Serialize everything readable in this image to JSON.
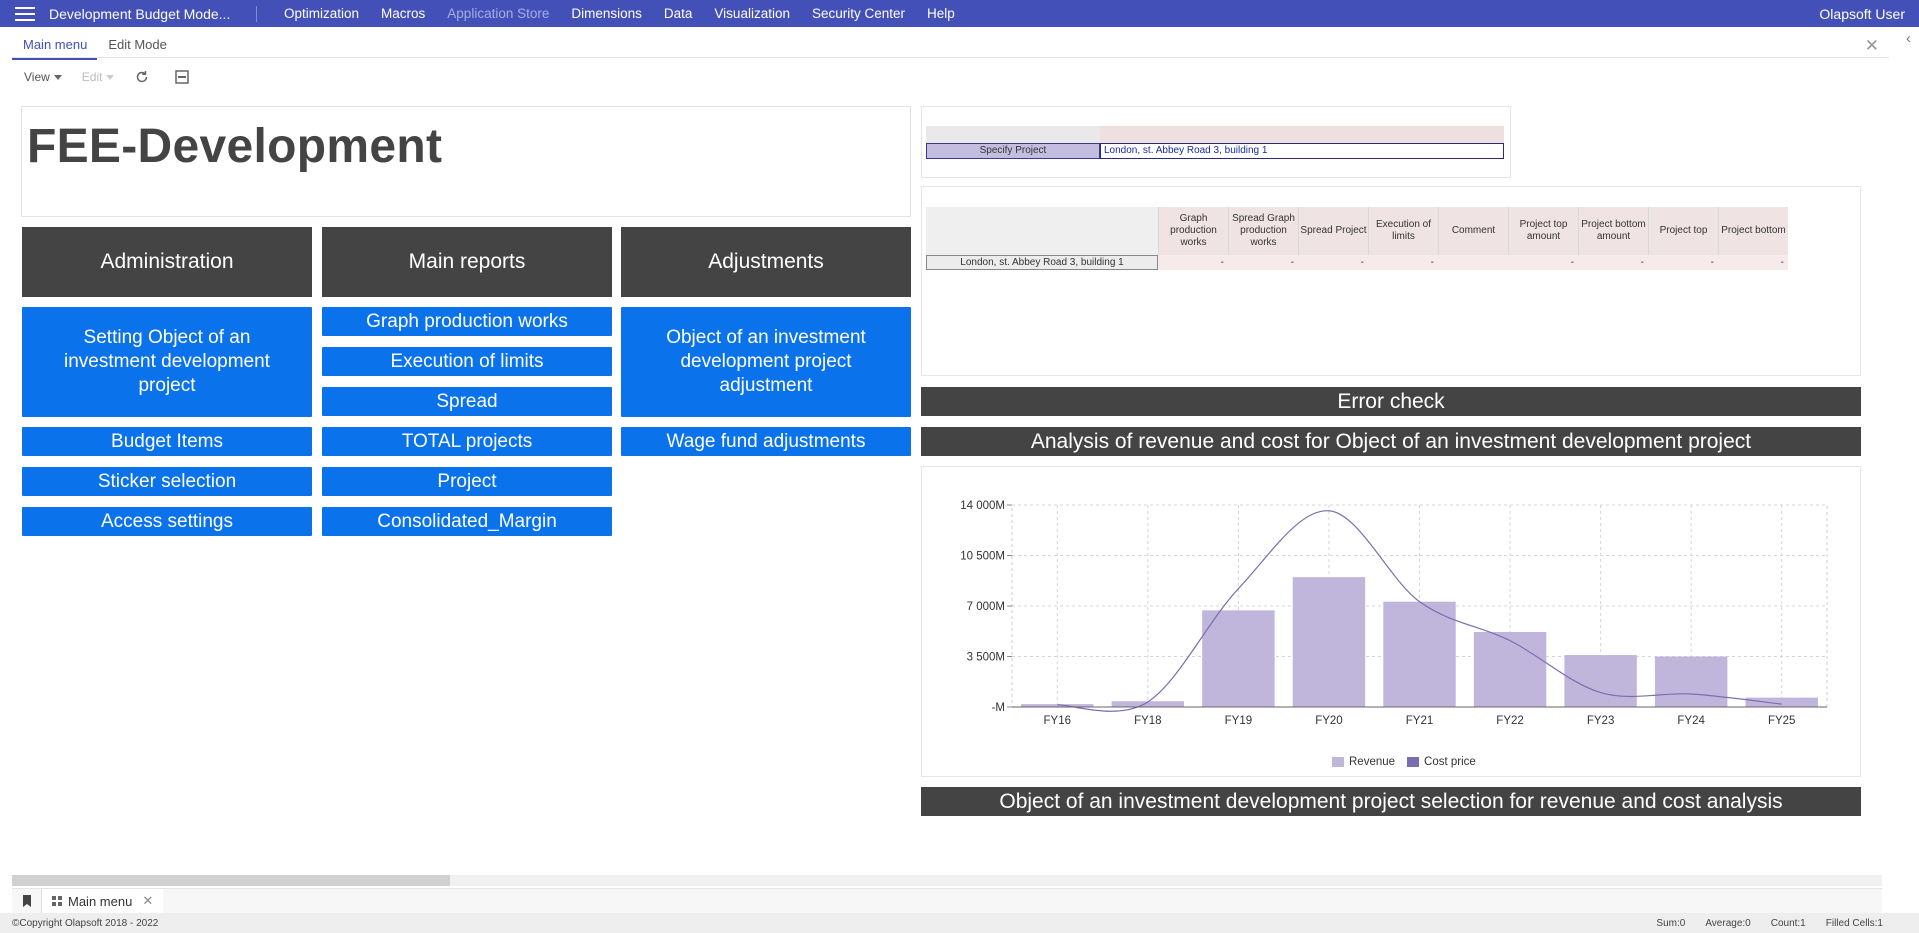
{
  "topbar": {
    "app_title": "Development Budget Mode...",
    "menu": [
      "Optimization",
      "Macros",
      "Application Store",
      "Dimensions",
      "Data",
      "Visualization",
      "Security Center",
      "Help"
    ],
    "disabled_menu": "Application Store",
    "user": "Olapsoft User"
  },
  "tabs": [
    "Main menu",
    "Edit Mode"
  ],
  "toolbar": {
    "view_label": "View",
    "edit_label": "Edit"
  },
  "page_title": "FEE-Development",
  "columns": {
    "administration": {
      "header": "Administration",
      "items": [
        "Setting Object of an investment development project",
        "Budget Items",
        "Sticker selection",
        "Access settings"
      ]
    },
    "main_reports": {
      "header": "Main reports",
      "items": [
        "Graph production works",
        "Execution of limits",
        "Spread",
        "TOTAL projects",
        "Project",
        "Consolidated_Margin"
      ]
    },
    "adjustments": {
      "header": "Adjustments",
      "items": [
        "Object of an investment development project adjustment",
        "Wage fund adjustments"
      ]
    }
  },
  "specify": {
    "label": "Specify Project",
    "value": "London, st. Abbey Road 3, building 1"
  },
  "grid": {
    "headers": [
      "Graph production works",
      "Spread Graph production works",
      "Spread Project",
      "Execution of limits",
      "Comment",
      "Project top amount",
      "Project bottom amount",
      "Project top",
      "Project bottom"
    ],
    "row_label": "London, st. Abbey Road 3, building 1",
    "row_values": [
      "-",
      "-",
      "-",
      "-",
      "",
      "-",
      "-",
      "-",
      "-"
    ]
  },
  "bars": {
    "error_check": "Error check",
    "analysis": "Analysis of revenue and cost for Object of an investment development project",
    "selection": "Object of an investment development project selection for revenue and cost analysis"
  },
  "chart_data": {
    "type": "bar",
    "categories": [
      "FY16",
      "FY18",
      "FY19",
      "FY20",
      "FY21",
      "FY22",
      "FY23",
      "FY24",
      "FY25"
    ],
    "series": [
      {
        "name": "Revenue",
        "kind": "bar",
        "color": "#c0b6dc",
        "values": [
          200,
          400,
          6700,
          9000,
          7300,
          5200,
          3600,
          3500,
          650
        ]
      },
      {
        "name": "Cost price",
        "kind": "line",
        "color": "#7d6db0",
        "values": [
          150,
          350,
          8200,
          13600,
          7300,
          4600,
          1000,
          900,
          200
        ]
      }
    ],
    "y_ticks": [
      "14 000M",
      "10 500M",
      "7 000M",
      "3 500M",
      "-M"
    ],
    "ylim": [
      0,
      14000
    ],
    "grid": true,
    "legend_position": "bottom"
  },
  "sheet_tab": "Main menu",
  "status": {
    "copyright": "©Copyright Olapsoft 2018 - 2022",
    "sum": "Sum:0",
    "average": "Average:0",
    "count": "Count:1",
    "filled": "Filled Cells:1"
  },
  "colors": {
    "topbar": "#4350b8",
    "button_blue": "#0a73ec",
    "header_dark": "#444444"
  }
}
